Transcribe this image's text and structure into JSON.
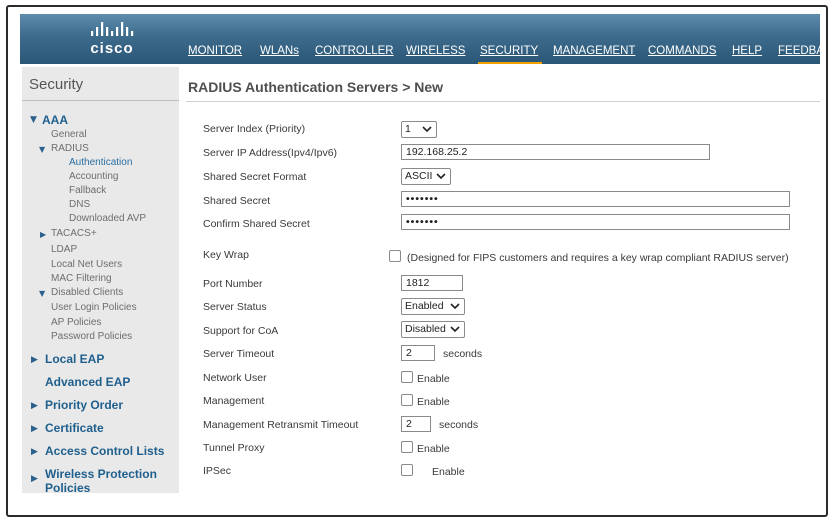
{
  "header": {
    "logo_text": "cisco",
    "nav": [
      {
        "label": "MONITOR"
      },
      {
        "label": "WLANs"
      },
      {
        "label": "CONTROLLER"
      },
      {
        "label": "WIRELESS"
      },
      {
        "label": "SECURITY",
        "active": true
      },
      {
        "label": "MANAGEMENT"
      },
      {
        "label": "COMMANDS"
      },
      {
        "label": "HELP"
      },
      {
        "label": "FEEDBA"
      }
    ],
    "accent_color": "#f2a000"
  },
  "sidebar": {
    "title": "Security",
    "aaa": "AAA",
    "general": "General",
    "radius": "RADIUS",
    "radius_items": [
      "Authentication",
      "Accounting",
      "Fallback",
      "DNS",
      "Downloaded AVP"
    ],
    "tacacs": "TACACS+",
    "ldap": "LDAP",
    "local_net_users": "Local Net Users",
    "mac_filtering": "MAC Filtering",
    "disabled_clients": "Disabled Clients",
    "user_login_policies": "User Login Policies",
    "ap_policies": "AP Policies",
    "password_policies": "Password Policies",
    "local_eap": "Local EAP",
    "advanced_eap": "Advanced EAP",
    "priority_order": "Priority Order",
    "certificate": "Certificate",
    "access_control_lists": "Access Control Lists",
    "wireless_protection_1": "Wireless Protection",
    "wireless_protection_2": "Policies"
  },
  "main": {
    "title": "RADIUS Authentication Servers > New",
    "server_index_label": "Server Index (Priority)",
    "server_index_value": "1",
    "server_ip_label": "Server IP Address(Ipv4/Ipv6)",
    "server_ip_value": "192.168.25.2",
    "secret_format_label": "Shared Secret Format",
    "secret_format_value": "ASCII",
    "shared_secret_label": "Shared Secret",
    "shared_secret_value": "•••••••",
    "confirm_secret_label": "Confirm Shared Secret",
    "confirm_secret_value": "•••••••",
    "key_wrap_label": "Key Wrap",
    "key_wrap_note": "(Designed for FIPS customers and requires a key wrap compliant RADIUS server)",
    "port_label": "Port Number",
    "port_value": "1812",
    "server_status_label": "Server Status",
    "server_status_value": "Enabled",
    "coa_label": "Support for CoA",
    "coa_value": "Disabled",
    "timeout_label": "Server Timeout",
    "timeout_value": "2",
    "timeout_unit": "seconds",
    "network_user_label": "Network User",
    "network_user_enable": "Enable",
    "management_label": "Management",
    "management_enable": "Enable",
    "mgmt_retransmit_label": "Management Retransmit Timeout",
    "mgmt_retransmit_value": "2",
    "mgmt_retransmit_unit": "seconds",
    "tunnel_proxy_label": "Tunnel Proxy",
    "tunnel_proxy_enable": "Enable",
    "ipsec_label": "IPSec",
    "ipsec_enable": "Enable"
  }
}
